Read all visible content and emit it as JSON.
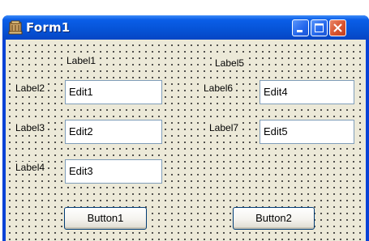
{
  "window": {
    "title": "Form1"
  },
  "title_buttons": {
    "minimize": "minimize",
    "maximize": "maximize",
    "close": "close"
  },
  "labels": [
    "Label1",
    "Label2",
    "Label3",
    "Label4",
    "Label5",
    "Label6",
    "Label7"
  ],
  "edits": [
    "Edit1",
    "Edit2",
    "Edit3",
    "Edit4",
    "Edit5"
  ],
  "buttons": [
    "Button1",
    "Button2"
  ],
  "colors": {
    "title_bar": "#0653d6",
    "client": "#ece9d8",
    "close_button": "#d7542f",
    "edit_border": "#7f9db9"
  }
}
